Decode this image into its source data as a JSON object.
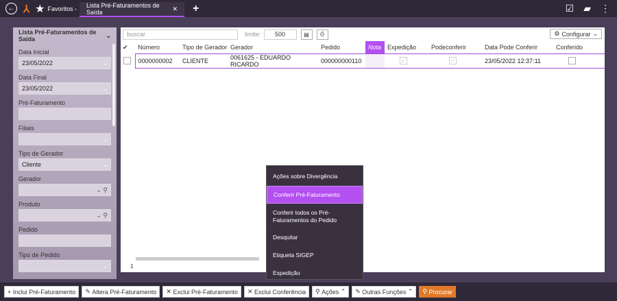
{
  "topbar": {
    "favorites": "Favoritos -",
    "tab_title": "Lista Pré-Faturamentos de Saída"
  },
  "sidebar": {
    "title": "Lista Pré-Faturamentos de Saída",
    "fields": [
      {
        "label": "Data Inicial",
        "value": "23/05/2022",
        "kind": "select"
      },
      {
        "label": "Data Final",
        "value": "23/05/2022",
        "kind": "select"
      },
      {
        "label": "Pré-Faturamento",
        "value": "",
        "kind": "text"
      },
      {
        "label": "Filiais",
        "value": "",
        "kind": "select"
      },
      {
        "label": "Tipo de Gerador",
        "value": "Cliente",
        "kind": "select"
      },
      {
        "label": "Gerador",
        "value": "",
        "kind": "search"
      },
      {
        "label": "Produto",
        "value": "",
        "kind": "search"
      },
      {
        "label": "Pedido",
        "value": "",
        "kind": "text"
      },
      {
        "label": "Tipo de Pedido",
        "value": "",
        "kind": "select"
      }
    ]
  },
  "toolbar": {
    "search_placeholder": "buscar",
    "limit_label": "limite:",
    "limit_value": "500",
    "config_label": "Configurar"
  },
  "table": {
    "columns": [
      "Número",
      "Tipo de Gerador",
      "Gerador",
      "Pedido",
      "Nota",
      "Expedição",
      "Podeconferir",
      "Data Pode Conferir",
      "Conferido"
    ],
    "rows": [
      {
        "numero": "0000000002",
        "tipo": "CLIENTE",
        "gerador": "0061625 - EDUARDO RICARDO",
        "pedido": "000000000110",
        "nota": "",
        "data": "23/05/2022 12:37:11"
      }
    ],
    "page": "1"
  },
  "menu": {
    "items": [
      "Ações sobre Divergência",
      "Conferir Pré-Faturamento",
      "Conferir todos os Pré-Faturamentos do Pedido",
      "Desquitar",
      "Etiqueta SIGEP",
      "Expedição"
    ],
    "active": 1
  },
  "bottom": {
    "buttons": [
      "Inclui Pré-Faturamento",
      "Altera Pré-Faturamento",
      "Exclui Pré-Faturamento",
      "Exclui Conferência",
      "Ações",
      "Outras Funções",
      "Procurar"
    ]
  }
}
